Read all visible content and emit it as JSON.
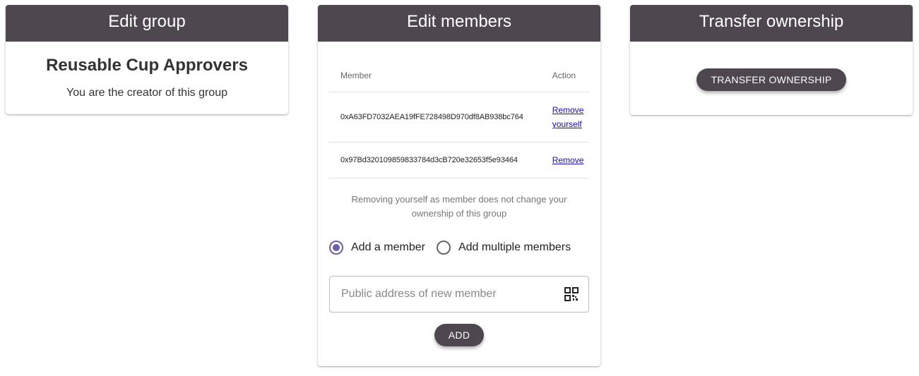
{
  "edit_group": {
    "title": "Edit group",
    "group_name": "Reusable Cup Approvers",
    "subtitle": "You are the creator of this group"
  },
  "edit_members": {
    "title": "Edit members",
    "columns": [
      "Member",
      "Action"
    ],
    "rows": [
      {
        "address": "0xA63FD7032AEA19fFE728498D970df8AB938bc764",
        "action_line1": "Remove",
        "action_line2": "yourself"
      },
      {
        "address": "0x97Bd320109859833784d3cB720e32653f5e93464",
        "action_line1": "Remove",
        "action_line2": ""
      }
    ],
    "note": "Removing yourself as member does not change your ownership of this group",
    "radio_options": [
      {
        "label": "Add a member",
        "checked": true
      },
      {
        "label": "Add multiple members",
        "checked": false
      }
    ],
    "input_placeholder": "Public address of new member",
    "input_value": "",
    "qr_icon": "qr-code-icon",
    "add_label": "Add"
  },
  "transfer": {
    "title": "Transfer ownership",
    "button_label": "Transfer ownership"
  },
  "colors": {
    "header_bg": "#4e4750",
    "accent": "#6e5cad",
    "link": "#1a0dab"
  }
}
